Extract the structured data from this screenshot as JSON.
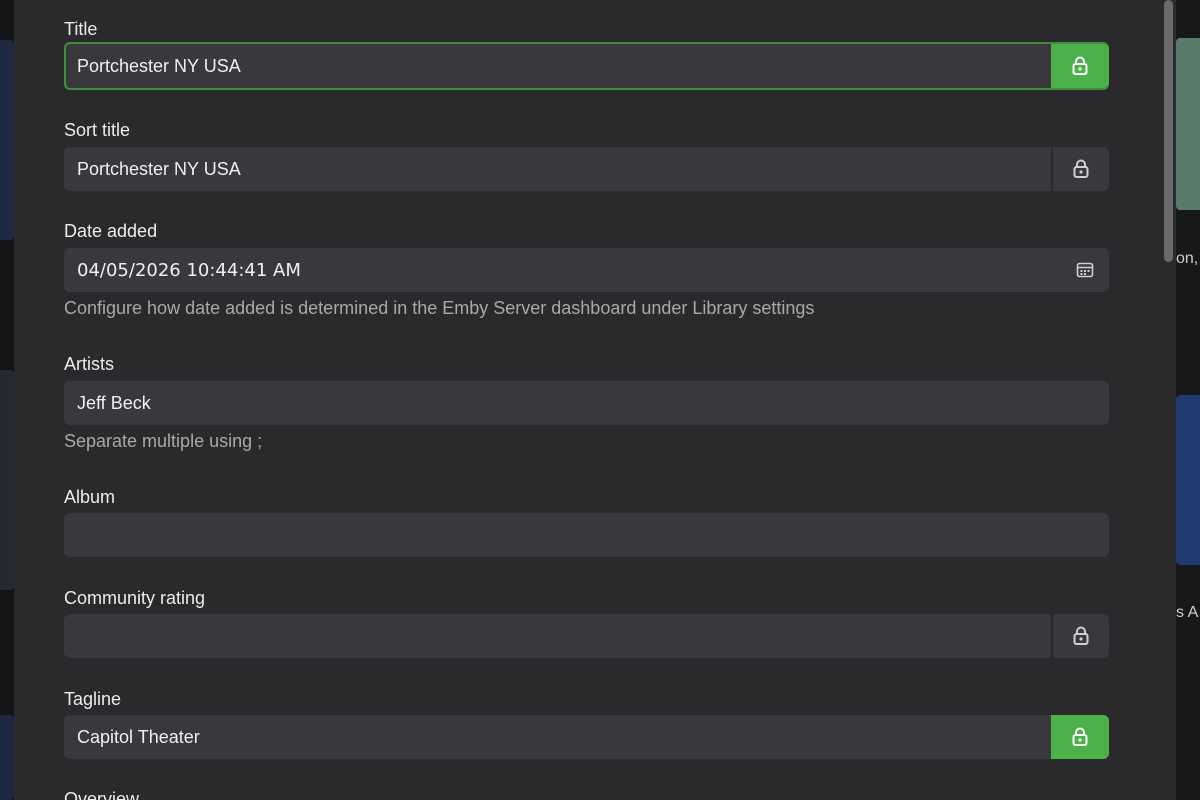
{
  "background": {
    "right_peek_texts": [
      "on,",
      "s A"
    ]
  },
  "form": {
    "title": {
      "label": "Title",
      "value": "Portchester NY USA",
      "locked": true
    },
    "sort_title": {
      "label": "Sort title",
      "value": "Portchester NY USA",
      "locked": false
    },
    "date_added": {
      "label": "Date added",
      "value": "04/05/2026 10:44:41 AM",
      "helper": "Configure how date added is determined in the Emby Server dashboard under Library settings"
    },
    "artists": {
      "label": "Artists",
      "value": "Jeff Beck",
      "helper": "Separate multiple using ;"
    },
    "album": {
      "label": "Album",
      "value": ""
    },
    "community_rating": {
      "label": "Community rating",
      "value": "",
      "locked": false
    },
    "tagline": {
      "label": "Tagline",
      "value": "Capitol Theater",
      "locked": true
    },
    "overview": {
      "label": "Overview"
    }
  },
  "colors": {
    "accent_green": "#4cb14a",
    "focus_border": "#3f8f3c",
    "panel": "#2a2a2c",
    "input": "#39393d"
  },
  "icons": {
    "lock": "lock-icon",
    "calendar": "calendar-icon"
  }
}
